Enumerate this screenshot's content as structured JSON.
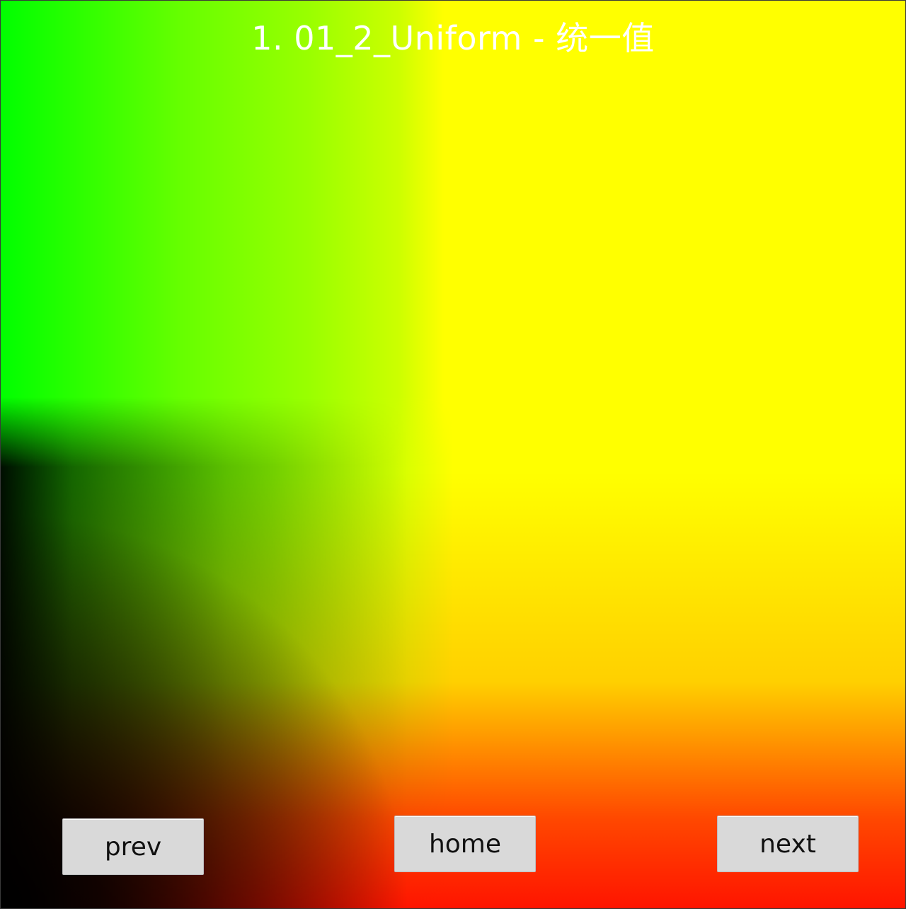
{
  "app": {
    "title": "1.  01_2_Uniform - 统一值"
  },
  "navigation": {
    "prev_label": "prev",
    "home_label": "home",
    "next_label": "next"
  },
  "colors": {
    "top_left": "#00ff00",
    "top_right": "#ffff00",
    "bottom_right": "#ff1a00",
    "bottom_left": "#000000",
    "title_text": "#ffffff",
    "button_bg": "#d9d9d9",
    "button_text": "#111111"
  }
}
